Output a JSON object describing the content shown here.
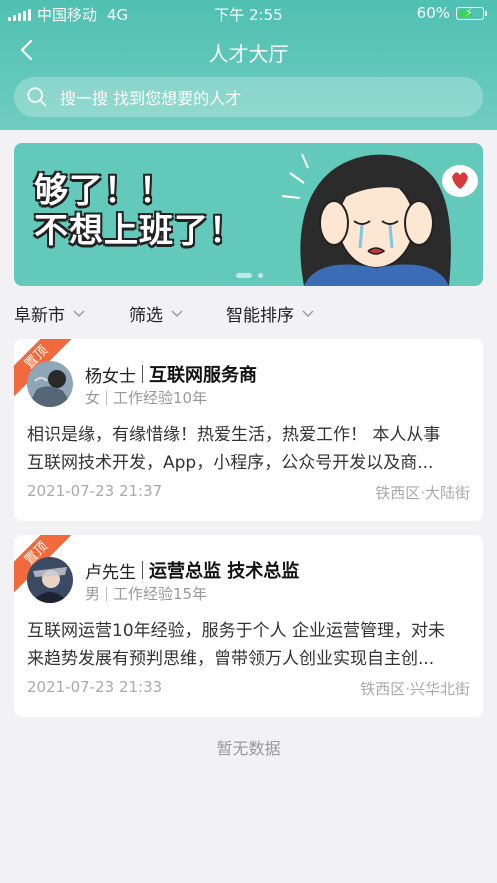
{
  "status_bar": {
    "carrier": "中国移动",
    "network": "4G",
    "time": "下午 2:55",
    "battery": "60%",
    "battery_level": 0.6
  },
  "nav": {
    "title": "人才大厅"
  },
  "search": {
    "placeholder": "搜一搜 找到您想要的人才"
  },
  "banner": {
    "line1": "够了！！",
    "line2": "不想上班了！"
  },
  "filters": [
    {
      "label": "阜新市"
    },
    {
      "label": "筛选"
    },
    {
      "label": "智能排序"
    }
  ],
  "cards": [
    {
      "badge": "置顶",
      "name": "杨女士",
      "title": "互联网服务商",
      "gender": "女",
      "experience": "工作经验10年",
      "desc_line1": "相识是缘，有缘惜缘！热爱生活，热爱工作！ 本人从事",
      "desc_line2": "互联网技术开发，App，小程序，公众号开发以及商...",
      "date": "2021-07-23 21:37",
      "location": "铁西区·大陆街"
    },
    {
      "badge": "置顶",
      "name": "卢先生",
      "title": "运营总监 技术总监",
      "gender": "男",
      "experience": "工作经验15年",
      "desc_line1": "互联网运营10年经验，服务于个人 企业运营管理，对未",
      "desc_line2": "来趋势发展有预判思维，曾带领万人创业实现自主创...",
      "date": "2021-07-23 21:33",
      "location": "铁西区·兴华北街"
    }
  ],
  "empty_text": "暂无数据"
}
